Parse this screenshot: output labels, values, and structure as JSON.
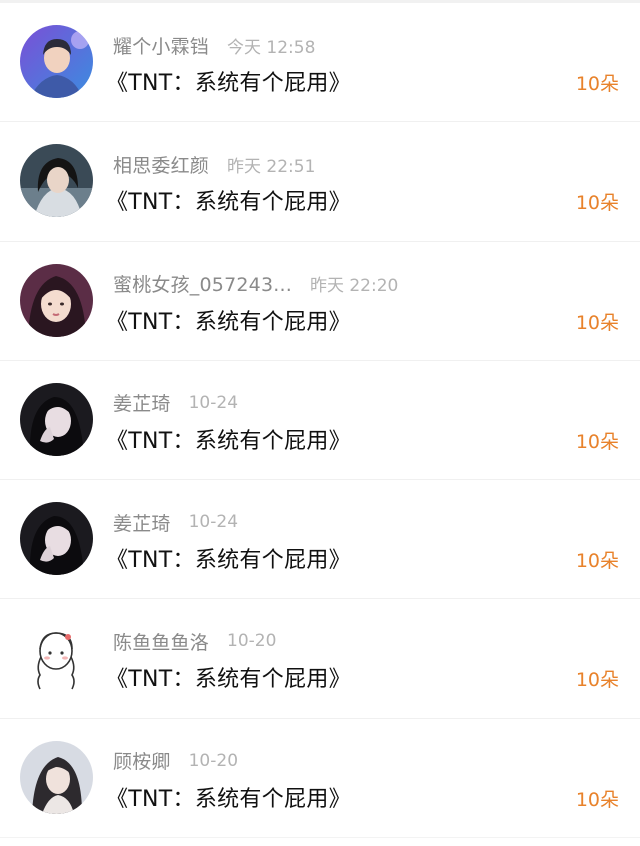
{
  "accent_color": "#e8822b",
  "gifts": [
    {
      "name": "耀个小霖铛",
      "time": "今天 12:58",
      "title": "《TNT：系统有个屁用》",
      "amount": "10朵",
      "avatar_icon": "avatar-boy-stage-icon"
    },
    {
      "name": "相思委红颜",
      "time": "昨天 22:51",
      "title": "《TNT：系统有个屁用》",
      "amount": "10朵",
      "avatar_icon": "avatar-girl-dark-icon"
    },
    {
      "name": "蜜桃女孩_057243...",
      "time": "昨天 22:20",
      "title": "《TNT：系统有个屁用》",
      "amount": "10朵",
      "avatar_icon": "avatar-girl-purple-icon"
    },
    {
      "name": "姜芷琦",
      "time": "10-24",
      "title": "《TNT：系统有个屁用》",
      "amount": "10朵",
      "avatar_icon": "avatar-girl-hand-icon"
    },
    {
      "name": "姜芷琦",
      "time": "10-24",
      "title": "《TNT：系统有个屁用》",
      "amount": "10朵",
      "avatar_icon": "avatar-girl-hand-icon"
    },
    {
      "name": "陈鱼鱼鱼洛",
      "time": "10-20",
      "title": "《TNT：系统有个屁用》",
      "amount": "10朵",
      "avatar_icon": "avatar-cartoon-braids-icon"
    },
    {
      "name": "顾桉卿",
      "time": "10-20",
      "title": "《TNT：系统有个屁用》",
      "amount": "10朵",
      "avatar_icon": "avatar-girl-light-icon"
    }
  ]
}
